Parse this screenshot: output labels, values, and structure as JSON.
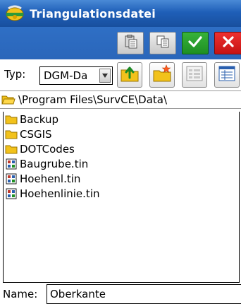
{
  "window": {
    "title": "Triangulationsdatei"
  },
  "toolbar": {
    "buttons": [
      {
        "icon": "paste-icon"
      },
      {
        "icon": "copy-icon"
      },
      {
        "icon": "checkmark-icon"
      },
      {
        "icon": "close-icon"
      }
    ],
    "colors": {
      "ok": "#1e8f22",
      "cancel": "#c51313",
      "titlebar": "#1f5fb8"
    }
  },
  "type_row": {
    "label": "Typ:",
    "selected": "DGM-Da",
    "buttons": [
      {
        "icon": "folder-up-icon"
      },
      {
        "icon": "new-folder-icon"
      },
      {
        "icon": "list-view-icon"
      },
      {
        "icon": "details-view-icon"
      }
    ]
  },
  "path": "\\Program Files\\SurvCE\\Data\\",
  "files": [
    {
      "name": "Backup",
      "kind": "folder"
    },
    {
      "name": "CSGIS",
      "kind": "folder"
    },
    {
      "name": "DOTCodes",
      "kind": "folder"
    },
    {
      "name": "Baugrube.tin",
      "kind": "tin-file"
    },
    {
      "name": "Hoehenl.tin",
      "kind": "tin-file"
    },
    {
      "name": "Hoehenlinie.tin",
      "kind": "tin-file"
    }
  ],
  "name_field": {
    "label": "Name:",
    "value": "Oberkante"
  }
}
